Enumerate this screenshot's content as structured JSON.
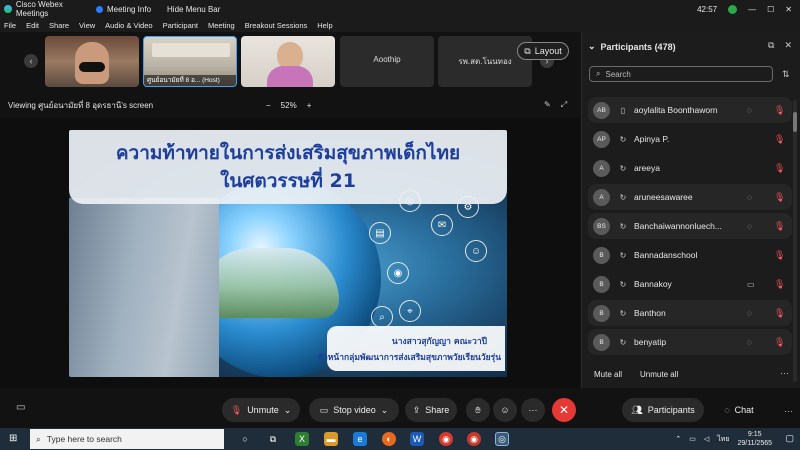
{
  "window": {
    "app_title": "Cisco Webex Meetings",
    "meeting_info": "Meeting Info",
    "hide_menu_bar": "Hide Menu Bar",
    "timer": "42:57"
  },
  "menu": [
    "File",
    "Edit",
    "Share",
    "View",
    "Audio & Video",
    "Participant",
    "Meeting",
    "Breakout Sessions",
    "Help"
  ],
  "thumbnails": {
    "names": [
      "",
      "ศูนย์อนามัยที่ 8 อ... (Host)",
      "",
      "Aoothip",
      "รพ.สต.โนนทอง"
    ],
    "layout_label": "Layout"
  },
  "viewbar": {
    "viewing": "Viewing ศูนย์อนามัยที่ 8 อุดรธานี's screen",
    "zoom": "52%",
    "zoom_out": "−",
    "zoom_in": "+"
  },
  "slide": {
    "title_line1": "ความท้าทายในการส่งเสริมสุขภาพเด็กไทย",
    "title_line2": "ในศตวรรษที่ 21",
    "presenter_name": "นางสาวสุกัญญา คณะวาปี",
    "presenter_role": "หัวหน้ากลุ่มพัฒนาการส่งเสริมสุขภาพวัยเรียนวัยรุ่น"
  },
  "controls": {
    "unmute": "Unmute",
    "stop_video": "Stop video",
    "share": "Share",
    "more": "···",
    "participants": "Participants",
    "chat": "Chat"
  },
  "participants_panel": {
    "title": "Participants (478)",
    "search_placeholder": "Search",
    "items": [
      {
        "initials": "AB",
        "name": "aoylalita Boonthaworn",
        "chat": true,
        "video": false
      },
      {
        "initials": "AP",
        "name": "Apinya P.",
        "chat": false,
        "video": false
      },
      {
        "initials": "A",
        "name": "areeya",
        "chat": false,
        "video": false
      },
      {
        "initials": "A",
        "name": "aruneesawaree",
        "chat": true,
        "video": false
      },
      {
        "initials": "BS",
        "name": "Banchaiwannonluech...",
        "chat": true,
        "video": false
      },
      {
        "initials": "B",
        "name": "Bannadanschool",
        "chat": false,
        "video": false
      },
      {
        "initials": "B",
        "name": "Bannakoy",
        "chat": false,
        "video": true
      },
      {
        "initials": "B",
        "name": "Banthon",
        "chat": true,
        "video": false
      },
      {
        "initials": "B",
        "name": "benyatip",
        "chat": true,
        "video": false
      }
    ],
    "mute_all": "Mute all",
    "unmute_all": "Unmute all"
  },
  "taskbar": {
    "search_placeholder": "Type here to search",
    "language": "ไทย",
    "time": "9:15",
    "date": "29/11/2565"
  },
  "colors": {
    "accent_blue": "#2d7cff",
    "leave_red": "#e53935",
    "muted_red": "#ff5a5a",
    "slide_title_blue": "#1d3f99"
  }
}
